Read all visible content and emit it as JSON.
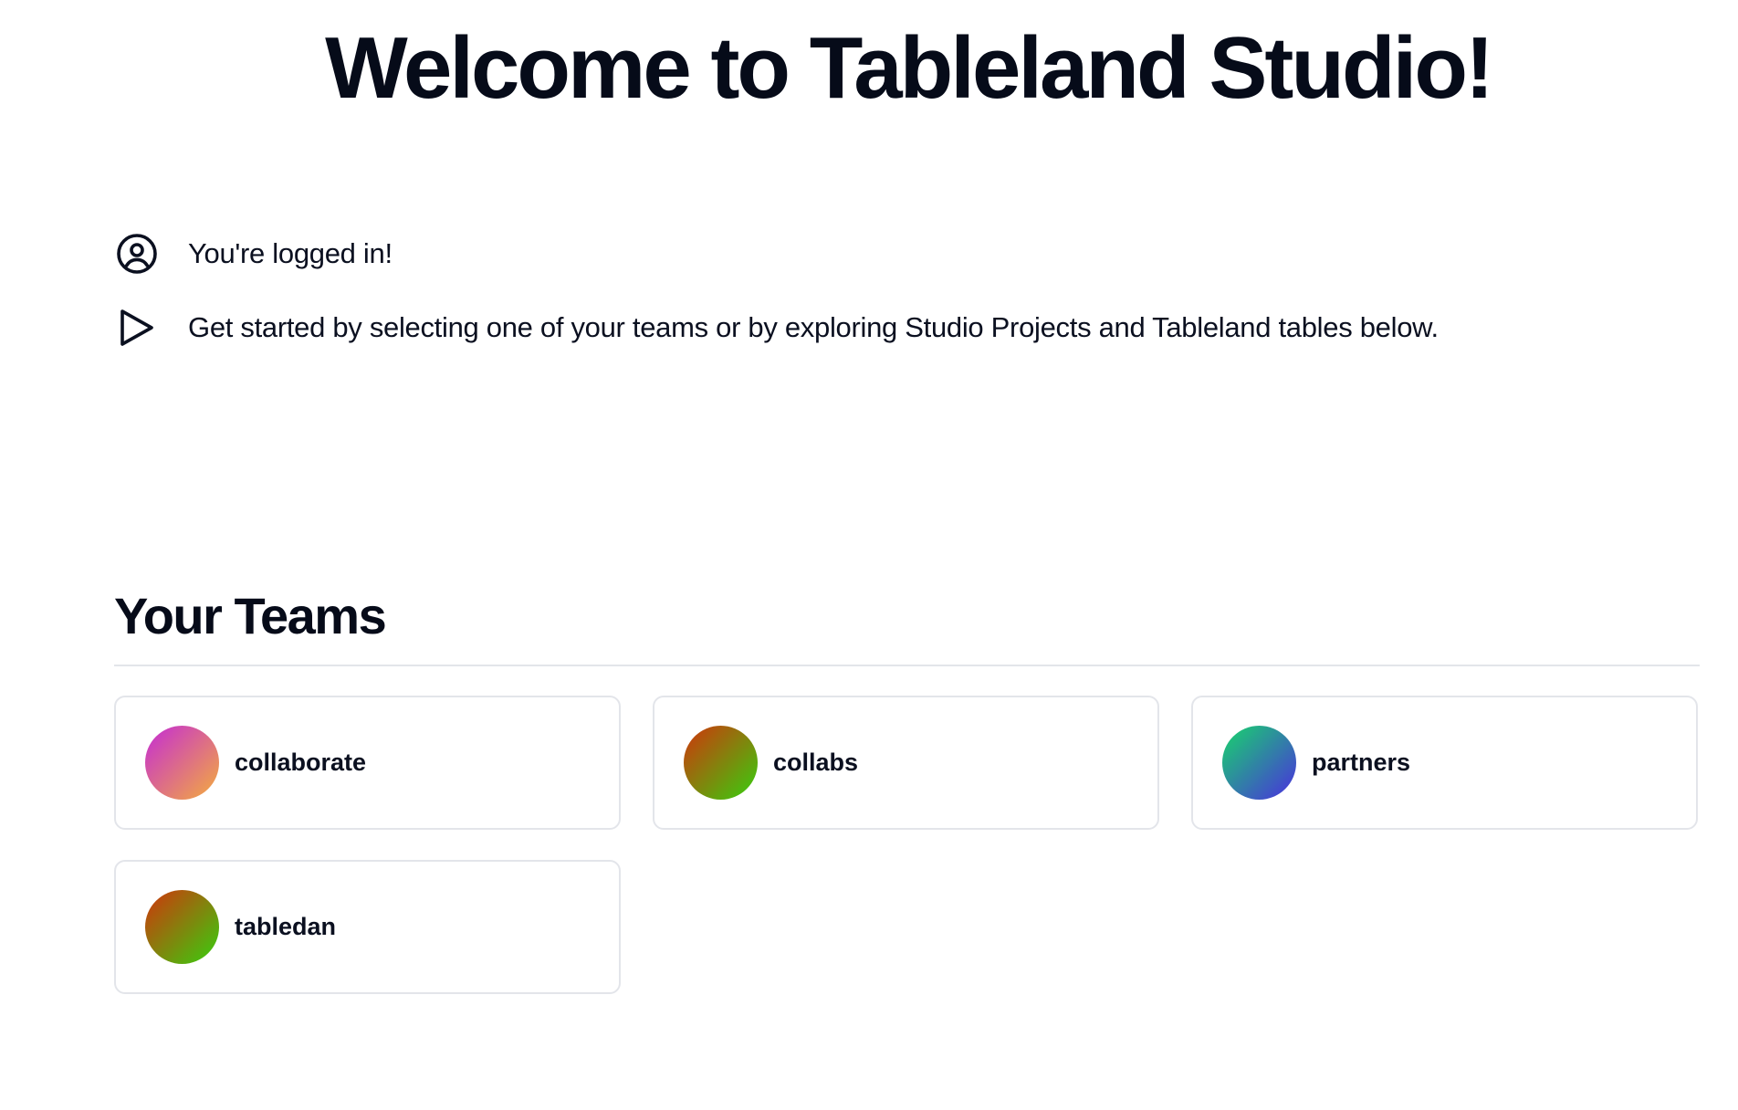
{
  "header": {
    "title": "Welcome to Tableland Studio!"
  },
  "info": [
    {
      "icon": "user-circle-icon",
      "text": "You're logged in!"
    },
    {
      "icon": "play-icon",
      "text": "Get started by selecting one of your teams or by exploring Studio Projects and Tableland tables below."
    }
  ],
  "teams_section": {
    "title": "Your Teams",
    "teams": [
      {
        "name": "collaborate",
        "avatar_colors": [
          "#c42bd6",
          "#f4ad3c"
        ]
      },
      {
        "name": "collabs",
        "avatar_colors": [
          "#d1340c",
          "#35d10e"
        ]
      },
      {
        "name": "partners",
        "avatar_colors": [
          "#17d66a",
          "#4a2ee0"
        ]
      },
      {
        "name": "tabledan",
        "avatar_colors": [
          "#d1340c",
          "#35d10e"
        ]
      }
    ]
  }
}
